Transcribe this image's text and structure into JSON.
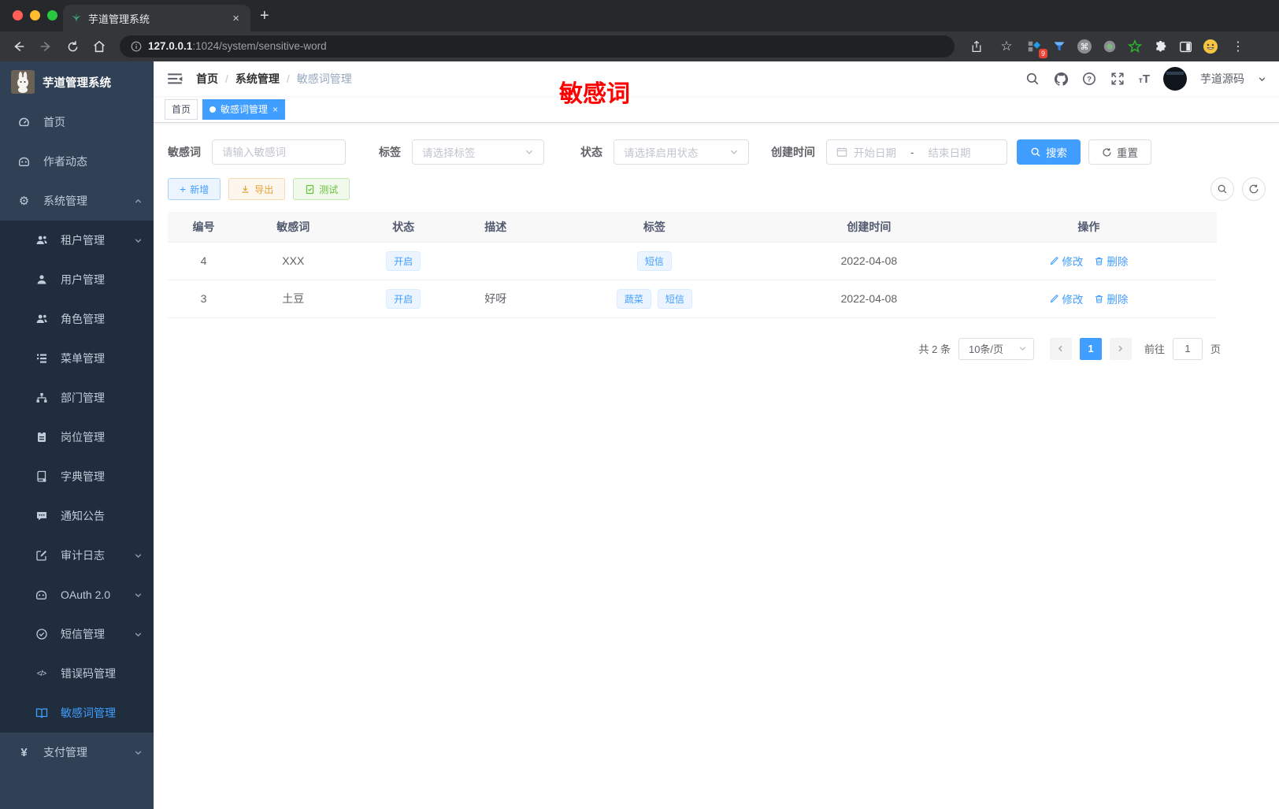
{
  "browser": {
    "tab_title": "芋道管理系统",
    "url_host": "127.0.0.1",
    "url_path": ":1024/system/sensitive-word",
    "extension_badge": "9"
  },
  "sidebar": {
    "title": "芋道管理系统",
    "top_items": [
      {
        "label": "首页"
      },
      {
        "label": "作者动态"
      },
      {
        "label": "系统管理"
      }
    ],
    "submenu_items": [
      {
        "label": "租户管理"
      },
      {
        "label": "用户管理"
      },
      {
        "label": "角色管理"
      },
      {
        "label": "菜单管理"
      },
      {
        "label": "部门管理"
      },
      {
        "label": "岗位管理"
      },
      {
        "label": "字典管理"
      },
      {
        "label": "通知公告"
      },
      {
        "label": "审计日志"
      },
      {
        "label": "OAuth 2.0"
      },
      {
        "label": "短信管理"
      },
      {
        "label": "错误码管理"
      },
      {
        "label": "敏感词管理"
      }
    ],
    "bottom_items": [
      {
        "label": "支付管理"
      }
    ]
  },
  "navbar": {
    "breadcrumb": [
      "首页",
      "系统管理",
      "敏感词管理"
    ],
    "username": "芋道源码"
  },
  "annotation": {
    "text": "敏感词",
    "color": "#fe0000"
  },
  "tags_view": {
    "tabs": [
      {
        "label": "首页"
      },
      {
        "label": "敏感词管理"
      }
    ]
  },
  "filters": {
    "keyword_label": "敏感词",
    "keyword_placeholder": "请输入敏感词",
    "tag_label": "标签",
    "tag_placeholder": "请选择标签",
    "status_label": "状态",
    "status_placeholder": "请选择启用状态",
    "date_label": "创建时间",
    "date_start": "开始日期",
    "date_separator": "-",
    "date_end": "结束日期",
    "search_label": "搜索",
    "reset_label": "重置"
  },
  "toolbar": {
    "add_label": "新增",
    "export_label": "导出",
    "test_label": "测试"
  },
  "table": {
    "columns": [
      "编号",
      "敏感词",
      "状态",
      "描述",
      "标签",
      "创建时间",
      "操作"
    ],
    "edit_label": "修改",
    "delete_label": "删除",
    "rows": [
      {
        "id": "4",
        "word": "XXX",
        "status": "开启",
        "desc": "",
        "tags": [
          "短信"
        ],
        "created": "2022-04-08"
      },
      {
        "id": "3",
        "word": "土豆",
        "status": "开启",
        "desc": "好呀",
        "tags": [
          "蔬菜",
          "短信"
        ],
        "created": "2022-04-08"
      }
    ]
  },
  "pagination": {
    "total_label": "共 2 条",
    "page_size": "10条/页",
    "current_page": "1",
    "goto_label": "前往",
    "goto_value": "1",
    "page_unit": "页"
  },
  "icons": {
    "close": "×",
    "plus": "+",
    "code": "</>",
    "yen": "¥",
    "gear": "⚙",
    "star": "☆",
    "dots": "⋮",
    "command": "⌘"
  },
  "colors": {
    "accent": "#409eff",
    "sidebar_bg": "#304156",
    "submenu_bg": "#1f2d3d",
    "warning": "#e6a23c",
    "success": "#67c23a"
  }
}
